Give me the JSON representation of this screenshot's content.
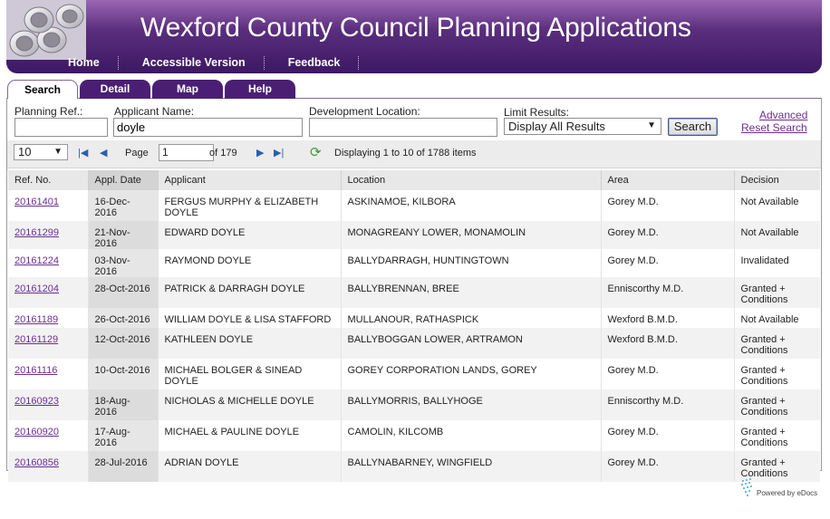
{
  "header": {
    "title": "Wexford County Council Planning Applications",
    "nav": [
      "Home",
      "Accessible Version",
      "Feedback"
    ]
  },
  "tabs": [
    {
      "label": "Search",
      "active": true
    },
    {
      "label": "Detail",
      "active": false
    },
    {
      "label": "Map",
      "active": false
    },
    {
      "label": "Help",
      "active": false
    }
  ],
  "search": {
    "planning_ref_label": "Planning Ref.:",
    "planning_ref_value": "",
    "applicant_label": "Applicant Name:",
    "applicant_value": "doyle",
    "location_label": "Development Location:",
    "location_value": "",
    "limit_label": "Limit Results:",
    "limit_value": "Display All Results",
    "search_button": "Search",
    "advanced_link": "Advanced",
    "reset_link": "Reset Search"
  },
  "pager": {
    "page_size": "10",
    "page_label": "Page",
    "page_value": "1",
    "of_label": "of 179",
    "displaying": "Displaying 1 to 10 of 1788 items"
  },
  "table": {
    "columns": [
      "Ref. No.",
      "Appl. Date",
      "Applicant",
      "Location",
      "Area",
      "Decision"
    ],
    "rows": [
      {
        "ref": "20161401",
        "date": "16-Dec-2016",
        "applicant": "FERGUS MURPHY & ELIZABETH DOYLE",
        "location": "ASKINAMOE, KILBORA",
        "area": "Gorey M.D.",
        "decision": "Not Available"
      },
      {
        "ref": "20161299",
        "date": "21-Nov-2016",
        "applicant": "EDWARD DOYLE",
        "location": "MONAGREANY LOWER, MONAMOLIN",
        "area": "Gorey M.D.",
        "decision": "Not Available"
      },
      {
        "ref": "20161224",
        "date": "03-Nov-2016",
        "applicant": "RAYMOND DOYLE",
        "location": "BALLYDARRAGH, HUNTINGTOWN",
        "area": "Gorey M.D.",
        "decision": "Invalidated"
      },
      {
        "ref": "20161204",
        "date": "28-Oct-2016",
        "applicant": "PATRICK & DARRAGH DOYLE",
        "location": "BALLYBRENNAN, BREE",
        "area": "Enniscorthy M.D.",
        "decision": "Granted + Conditions"
      },
      {
        "ref": "20161189",
        "date": "26-Oct-2016",
        "applicant": "WILLIAM DOYLE & LISA STAFFORD",
        "location": "MULLANOUR, RATHASPICK",
        "area": "Wexford B.M.D.",
        "decision": "Not Available"
      },
      {
        "ref": "20161129",
        "date": "12-Oct-2016",
        "applicant": "KATHLEEN DOYLE",
        "location": "BALLYBOGGAN LOWER, ARTRAMON",
        "area": "Wexford B.M.D.",
        "decision": "Granted + Conditions"
      },
      {
        "ref": "20161116",
        "date": "10-Oct-2016",
        "applicant": "MICHAEL BOLGER & SINEAD DOYLE",
        "location": "GOREY CORPORATION LANDS, GOREY",
        "area": "Gorey M.D.",
        "decision": "Granted + Conditions"
      },
      {
        "ref": "20160923",
        "date": "18-Aug-2016",
        "applicant": "NICHOLAS & MICHELLE DOYLE",
        "location": "BALLYMORRIS, BALLYHOGE",
        "area": "Enniscorthy M.D.",
        "decision": "Granted + Conditions"
      },
      {
        "ref": "20160920",
        "date": "17-Aug-2016",
        "applicant": "MICHAEL & PAULINE DOYLE",
        "location": "CAMOLIN, KILCOMB",
        "area": "Gorey M.D.",
        "decision": "Granted + Conditions"
      },
      {
        "ref": "20160856",
        "date": "28-Jul-2016",
        "applicant": "ADRIAN DOYLE",
        "location": "BALLYNABARNEY, WINGFIELD",
        "area": "Gorey M.D.",
        "decision": "Granted + Conditions"
      }
    ]
  },
  "footer": {
    "powered_by": "Powered by eDocs"
  },
  "colors": {
    "brand_purple": "#4a1f73",
    "link": "#6b2f8f"
  }
}
